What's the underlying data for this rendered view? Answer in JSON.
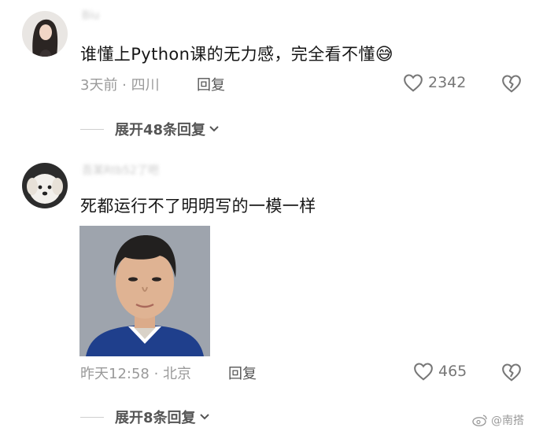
{
  "comments": [
    {
      "username": "Biu",
      "text": "谁懂上Python课的无力感，完全看不懂",
      "emoji": "😅",
      "meta": "3天前 · 四川",
      "reply_label": "回复",
      "likes": "2342",
      "expand_label": "展开48条回复"
    },
    {
      "username": "吾某Rtb52了吧",
      "text": "死都运行不了明明写的一模一样",
      "meta": "昨天12:58 · 北京",
      "reply_label": "回复",
      "likes": "465",
      "expand_label": "展开8条回复"
    }
  ],
  "watermark": "@南搭",
  "colors": {
    "meta": "#9a9a9a",
    "icon": "#777777",
    "divider": "#cfcfcf"
  }
}
